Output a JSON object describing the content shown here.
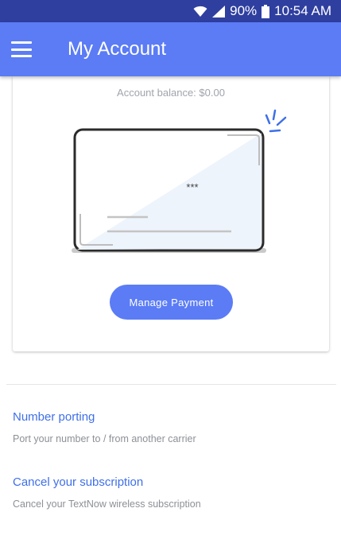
{
  "status_bar": {
    "battery": "90%",
    "time": "10:54 AM",
    "icons": [
      "wifi-icon",
      "signal-icon",
      "battery-icon"
    ]
  },
  "app_bar": {
    "title": "My Account",
    "menu_icon": "hamburger-menu-icon"
  },
  "card": {
    "balance": "Account balance: $0.00",
    "card_masked_number": "***",
    "button_label": "Manage Payment"
  },
  "options": [
    {
      "title": "Number porting",
      "subtitle": "Port your number to / from another carrier"
    },
    {
      "title": "Cancel your subscription",
      "subtitle": "Cancel your TextNow wireless subscription"
    }
  ],
  "colors": {
    "status_bar": "#2f3fa0",
    "app_bar": "#5b7cf5",
    "accent": "#3f6fe8",
    "card_fill": "#eef4fc"
  }
}
